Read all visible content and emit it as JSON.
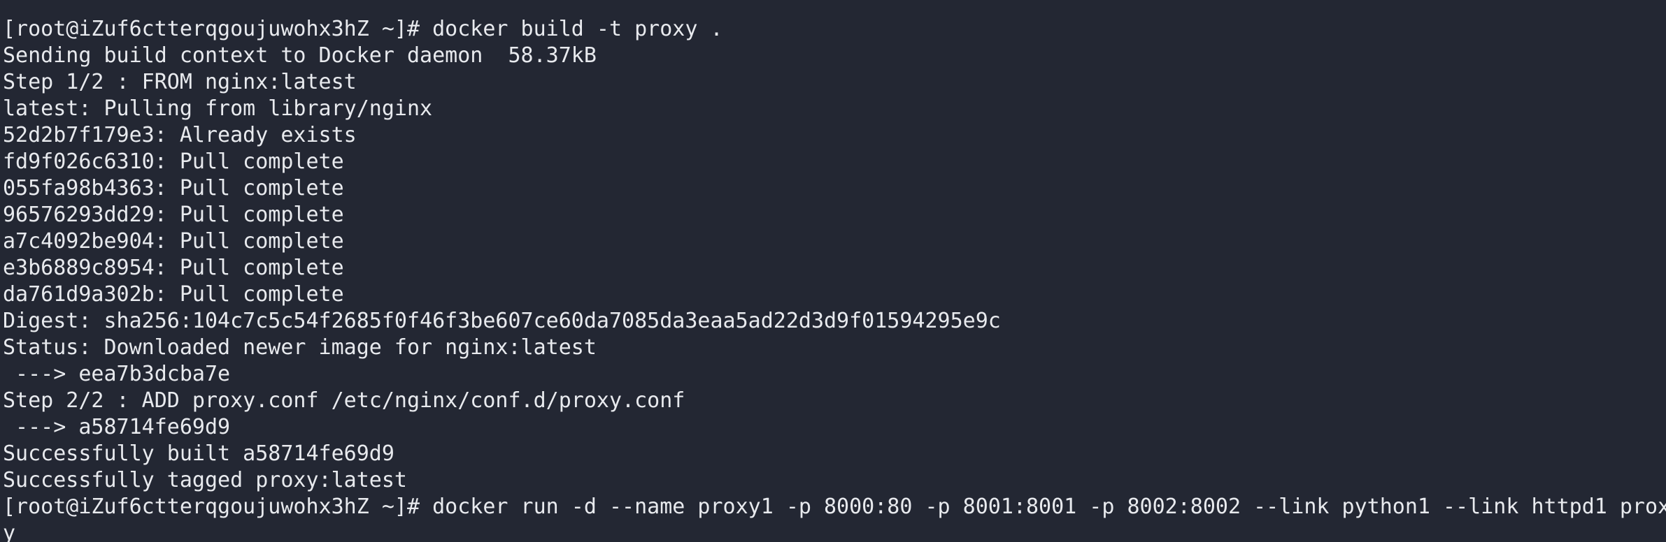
{
  "terminal": {
    "partial_top_line": "",
    "lines": [
      "[root@iZuf6ctterqgoujuwohx3hZ ~]# docker build -t proxy .",
      "Sending build context to Docker daemon  58.37kB",
      "Step 1/2 : FROM nginx:latest",
      "latest: Pulling from library/nginx",
      "52d2b7f179e3: Already exists",
      "fd9f026c6310: Pull complete",
      "055fa98b4363: Pull complete",
      "96576293dd29: Pull complete",
      "a7c4092be904: Pull complete",
      "e3b6889c8954: Pull complete",
      "da761d9a302b: Pull complete",
      "Digest: sha256:104c7c5c54f2685f0f46f3be607ce60da7085da3eaa5ad22d3d9f01594295e9c",
      "Status: Downloaded newer image for nginx:latest",
      " ---> eea7b3dcba7e",
      "Step 2/2 : ADD proxy.conf /etc/nginx/conf.d/proxy.conf",
      " ---> a58714fe69d9",
      "Successfully built a58714fe69d9",
      "Successfully tagged proxy:latest",
      "[root@iZuf6ctterqgoujuwohx3hZ ~]# docker run -d --name proxy1 -p 8000:80 -p 8001:8001 -p 8002:8002 --link python1 --link httpd1 prox",
      "y"
    ]
  },
  "colors": {
    "background": "#232733",
    "text": "#e8eaee"
  }
}
